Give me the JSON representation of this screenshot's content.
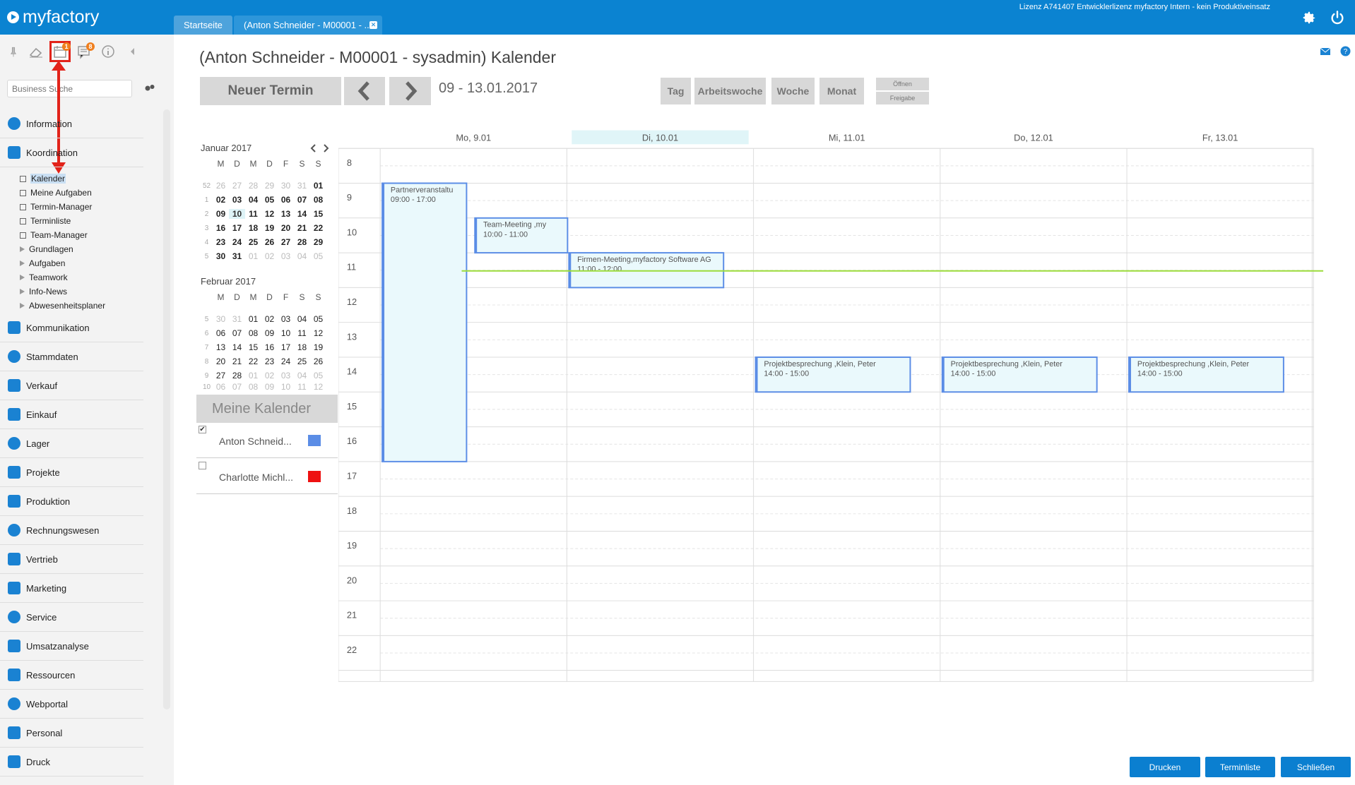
{
  "app": {
    "brand": "myfactory",
    "license": "Lizenz A741407 Entwicklerlizenz myfactory Intern - kein Produktiveinsatz"
  },
  "tabs": [
    {
      "label": "Startseite"
    },
    {
      "label": "(Anton Schneider - M00001 - ..."
    }
  ],
  "toolbar_icons": [
    {
      "icon": "pin-icon"
    },
    {
      "icon": "eraser-icon"
    },
    {
      "icon": "calendar-icon",
      "badge": "1"
    },
    {
      "icon": "message-icon",
      "badge": "8"
    },
    {
      "icon": "info-icon"
    },
    {
      "icon": "collapse-left-icon"
    }
  ],
  "search": {
    "placeholder": "Business Suche"
  },
  "nav": {
    "main": [
      {
        "label": "Information",
        "icon": "info-icon"
      },
      {
        "label": "Koordination",
        "icon": "sitemap-icon"
      },
      {
        "label": "Kommunikation",
        "icon": "chat-icon"
      },
      {
        "label": "Stammdaten",
        "icon": "database-icon"
      },
      {
        "label": "Verkauf",
        "icon": "coins-icon"
      },
      {
        "label": "Einkauf",
        "icon": "cart-icon"
      },
      {
        "label": "Lager",
        "icon": "warehouse-icon"
      },
      {
        "label": "Projekte",
        "icon": "chart-board-icon"
      },
      {
        "label": "Produktion",
        "icon": "production-icon"
      },
      {
        "label": "Rechnungswesen",
        "icon": "grid-icon"
      },
      {
        "label": "Vertrieb",
        "icon": "target-icon"
      },
      {
        "label": "Marketing",
        "icon": "pie-icon"
      },
      {
        "label": "Service",
        "icon": "gear-icon"
      },
      {
        "label": "Umsatzanalyse",
        "icon": "bar-chart-icon"
      },
      {
        "label": "Ressourcen",
        "icon": "doc-icon"
      },
      {
        "label": "Webportal",
        "icon": "portal-icon"
      },
      {
        "label": "Personal",
        "icon": "people-icon"
      },
      {
        "label": "Druck",
        "icon": "printer-icon"
      }
    ],
    "sub": [
      {
        "label": "Kalender"
      },
      {
        "label": "Meine Aufgaben"
      },
      {
        "label": "Termin-Manager"
      },
      {
        "label": "Terminliste"
      },
      {
        "label": "Team-Manager"
      },
      {
        "label": "Grundlagen"
      },
      {
        "label": "Aufgaben"
      },
      {
        "label": "Teamwork"
      },
      {
        "label": "Info-News"
      },
      {
        "label": "Abwesenheitsplaner"
      }
    ]
  },
  "page": {
    "title": "(Anton Schneider - M00001 - sysadmin) Kalender"
  },
  "buttons": {
    "new": "Neuer Termin",
    "date_range": "09 - 13.01.2017",
    "tag": "Tag",
    "arbeitswoche": "Arbeitswoche",
    "woche": "Woche",
    "monat": "Monat",
    "oeffnen": "Öffnen",
    "freigabe": "Freigabe",
    "drucken": "Drucken",
    "terminliste": "Terminliste",
    "schliessen": "Schließen"
  },
  "minical": {
    "dow": [
      "M",
      "D",
      "M",
      "D",
      "F",
      "S",
      "S"
    ],
    "months": [
      {
        "title": "Januar 2017",
        "weeks": [
          {
            "wn": "52",
            "days": [
              "26",
              "27",
              "28",
              "29",
              "30",
              "31",
              "01"
            ]
          },
          {
            "wn": "1",
            "days": [
              "02",
              "03",
              "04",
              "05",
              "06",
              "07",
              "08"
            ]
          },
          {
            "wn": "2",
            "days": [
              "09",
              "10",
              "11",
              "12",
              "13",
              "14",
              "15"
            ]
          },
          {
            "wn": "3",
            "days": [
              "16",
              "17",
              "18",
              "19",
              "20",
              "21",
              "22"
            ]
          },
          {
            "wn": "4",
            "days": [
              "23",
              "24",
              "25",
              "26",
              "27",
              "28",
              "29"
            ]
          },
          {
            "wn": "5",
            "days": [
              "30",
              "31",
              "01",
              "02",
              "03",
              "04",
              "05"
            ]
          }
        ]
      },
      {
        "title": "Februar 2017",
        "weeks": [
          {
            "wn": "5",
            "days": [
              "30",
              "31",
              "01",
              "02",
              "03",
              "04",
              "05"
            ]
          },
          {
            "wn": "6",
            "days": [
              "06",
              "07",
              "08",
              "09",
              "10",
              "11",
              "12"
            ]
          },
          {
            "wn": "7",
            "days": [
              "13",
              "14",
              "15",
              "16",
              "17",
              "18",
              "19"
            ]
          },
          {
            "wn": "8",
            "days": [
              "20",
              "21",
              "22",
              "23",
              "24",
              "25",
              "26"
            ]
          },
          {
            "wn": "9",
            "days": [
              "27",
              "28",
              "01",
              "02",
              "03",
              "04",
              "05"
            ]
          },
          {
            "wn": "10",
            "days": [
              "06",
              "07",
              "08",
              "09",
              "10",
              "11",
              "12"
            ]
          }
        ]
      }
    ]
  },
  "my_calendars": {
    "title": "Meine Kalender",
    "items": [
      {
        "name": "Anton Schneid...",
        "checked": true,
        "color": "#5b8de6"
      },
      {
        "name": "Charlotte Michl...",
        "checked": false,
        "color": "#ee1111"
      }
    ]
  },
  "week": {
    "days": [
      "Mo, 9.01",
      "Di, 10.01",
      "Mi, 11.01",
      "Do, 12.01",
      "Fr, 13.01"
    ],
    "today_index": 1,
    "hours": [
      "8",
      "9",
      "10",
      "11",
      "12",
      "13",
      "14",
      "15",
      "16",
      "17",
      "18",
      "19",
      "20",
      "21",
      "22"
    ],
    "now_hour": 11.5,
    "events": [
      {
        "title": "Partnerveranstaltu",
        "time": "09:00 - 17:00",
        "day": 0,
        "start": 9,
        "end": 17,
        "col": 0,
        "cols": 2
      },
      {
        "title": "Team-Meeting ,my",
        "time": "10:00 - 11:00",
        "day": 0,
        "start": 10,
        "end": 11,
        "col": 1,
        "cols": 2
      },
      {
        "title": "Firmen-Meeting,myfactory Software AG",
        "time": "11:00 - 12:00",
        "day": 1,
        "start": 11,
        "end": 12,
        "col": 0,
        "cols": 1
      },
      {
        "title": "Projektbesprechung ,Klein, Peter",
        "time": "14:00 - 15:00",
        "day": 2,
        "start": 14,
        "end": 15,
        "col": 0,
        "cols": 1
      },
      {
        "title": "Projektbesprechung ,Klein, Peter",
        "time": "14:00 - 15:00",
        "day": 3,
        "start": 14,
        "end": 15,
        "col": 0,
        "cols": 1
      },
      {
        "title": "Projektbesprechung ,Klein, Peter",
        "time": "14:00 - 15:00",
        "day": 4,
        "start": 14,
        "end": 15,
        "col": 0,
        "cols": 1
      }
    ]
  }
}
